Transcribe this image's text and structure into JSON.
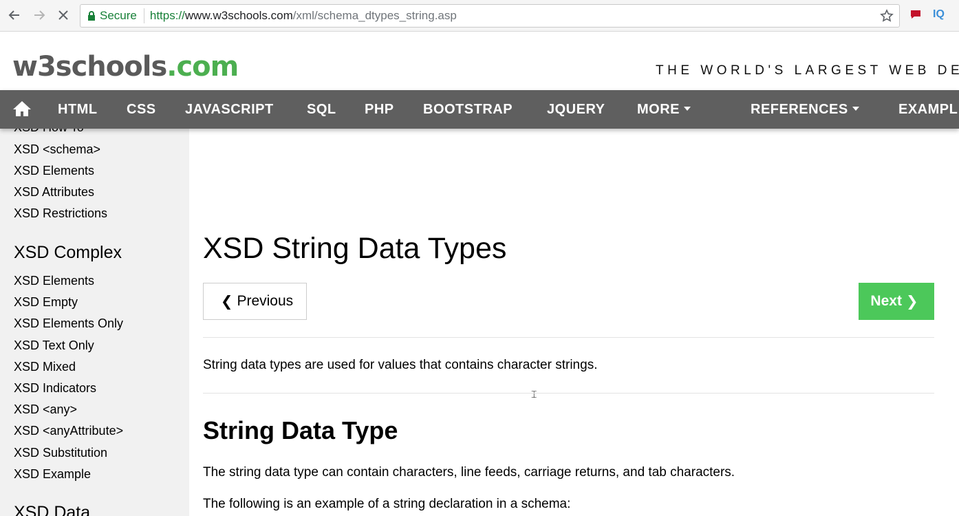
{
  "browser": {
    "secure_label": "Secure",
    "url_scheme": "https://",
    "url_host": "www.w3schools.com",
    "url_path": "/xml/schema_dtypes_string.asp",
    "ext_iq": "IQ"
  },
  "header": {
    "logo_main": "w3schools",
    "logo_tld": ".com",
    "tagline": "THE WORLD'S LARGEST WEB DEV"
  },
  "topnav": {
    "items": [
      "HTML",
      "CSS",
      "JAVASCRIPT",
      "SQL",
      "PHP",
      "BOOTSTRAP",
      "JQUERY",
      "MORE",
      "REFERENCES",
      "EXAMPL"
    ]
  },
  "sidebar": {
    "partial_item": "XSD How To",
    "group1": [
      "XSD <schema>",
      "XSD Elements",
      "XSD Attributes",
      "XSD Restrictions"
    ],
    "heading_complex": "XSD Complex",
    "group2": [
      "XSD Elements",
      "XSD Empty",
      "XSD Elements Only",
      "XSD Text Only",
      "XSD Mixed",
      "XSD Indicators",
      "XSD <any>",
      "XSD <anyAttribute>",
      "XSD Substitution",
      "XSD Example"
    ],
    "heading_data": "XSD Data"
  },
  "main": {
    "title": "XSD String Data Types",
    "prev_label": "Previous",
    "next_label": "Next",
    "intro": "String data types are used for values that contains character strings.",
    "section_heading": "String Data Type",
    "para1": "The string data type can contain characters, line feeds, carriage returns, and tab characters.",
    "para2": "The following is an example of a string declaration in a schema:"
  },
  "colors": {
    "nav_bg": "#5f5f5f",
    "sidebar_bg": "#f1f1f1",
    "next_button": "#4cc85a",
    "logo_green": "#4caf50",
    "secure_green": "#188038"
  }
}
